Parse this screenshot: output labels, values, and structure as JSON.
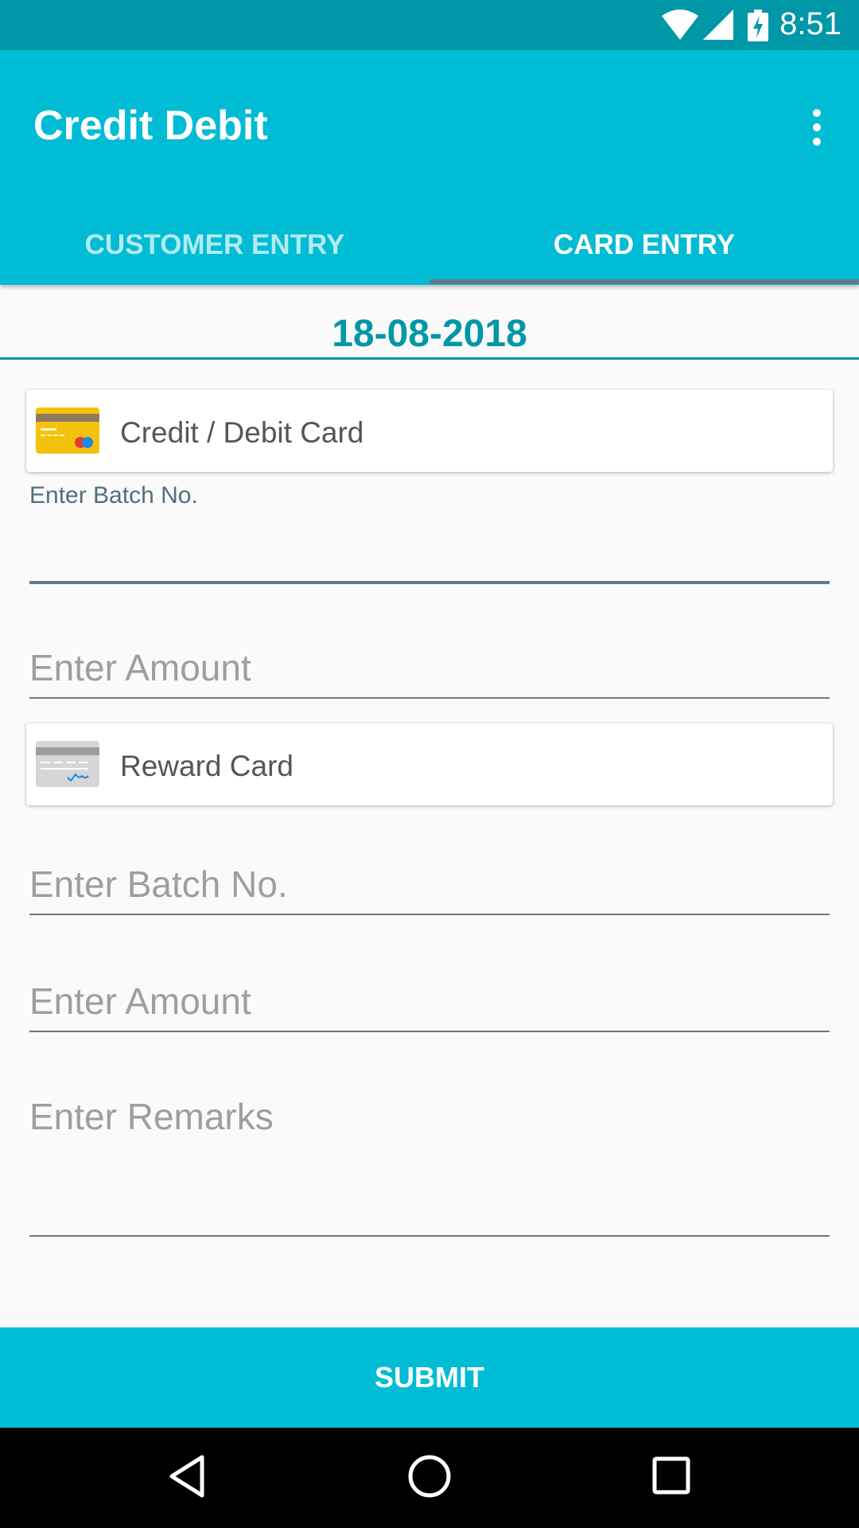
{
  "status_bar": {
    "time": "8:51"
  },
  "app_bar": {
    "title": "Credit Debit"
  },
  "tabs": [
    {
      "label": "CUSTOMER ENTRY",
      "selected": false
    },
    {
      "label": "CARD ENTRY",
      "selected": true
    }
  ],
  "date": "18-08-2018",
  "credit_debit_card": {
    "label": "Credit / Debit Card",
    "batch_label": "Enter Batch No.",
    "batch_value": "",
    "amount_placeholder": "Enter Amount"
  },
  "reward_card": {
    "label": "Reward Card",
    "batch_placeholder": "Enter Batch No.",
    "amount_placeholder": "Enter Amount"
  },
  "remarks_placeholder": "Enter Remarks",
  "submit_label": "SUBMIT",
  "colors": {
    "primary": "#00bcd4",
    "primary_dark": "#0097a7",
    "accent_indicator": "#607d8b"
  },
  "icons": {
    "status": [
      "wifi-icon",
      "signal-icon",
      "battery-charging-icon"
    ],
    "app_bar": "more-vert-icon",
    "cards": [
      "credit-card-icon",
      "reward-card-icon"
    ],
    "nav": [
      "back-icon",
      "home-icon",
      "recents-icon"
    ]
  }
}
